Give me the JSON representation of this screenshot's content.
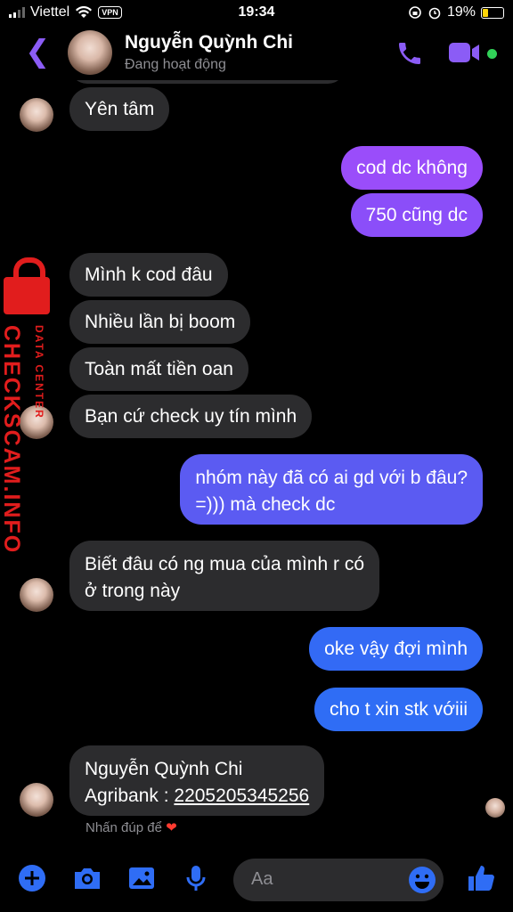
{
  "status_bar": {
    "carrier": "Viettel",
    "vpn": "VPN",
    "time": "19:34",
    "battery": "19%"
  },
  "header": {
    "name": "Nguyễn Quỳnh Chi",
    "status": "Đang hoạt động"
  },
  "messages": [
    {
      "dir": "in",
      "text": "Yên tâm"
    },
    {
      "dir": "out",
      "text": "cod dc không"
    },
    {
      "dir": "out",
      "text": "750 cũng dc"
    },
    {
      "dir": "in",
      "text": "Mình k cod đâu"
    },
    {
      "dir": "in",
      "text": "Nhiều lần bị boom"
    },
    {
      "dir": "in",
      "text": "Toàn mất tiền oan"
    },
    {
      "dir": "in",
      "text": "Bạn cứ check uy tín mình"
    },
    {
      "dir": "out",
      "lines": [
        "nhóm này đã có ai gd với b đâu?",
        "=))) mà check dc"
      ]
    },
    {
      "dir": "in",
      "lines": [
        "Biết đâu có ng mua của mình r có",
        "ở trong này"
      ]
    },
    {
      "dir": "out",
      "text": "oke vậy đợi mình"
    },
    {
      "dir": "out",
      "text": "cho t xin stk vớiii"
    },
    {
      "dir": "in",
      "lines": [
        "Nguyễn Quỳnh Chi",
        "Agribank : "
      ],
      "account": "2205205345256"
    }
  ],
  "hint": "Nhấn đúp để",
  "composer": {
    "placeholder": "Aa"
  },
  "watermark": {
    "main": "CHECKSCAM.INFO",
    "sub": "DATA CENTER"
  },
  "colors": {
    "accent": "#8b5cf6",
    "out_top": "#9a4dfa",
    "out_mid": "#5b5bf2",
    "out_bottom": "#2f6df5",
    "incoming": "#2c2c2e"
  }
}
